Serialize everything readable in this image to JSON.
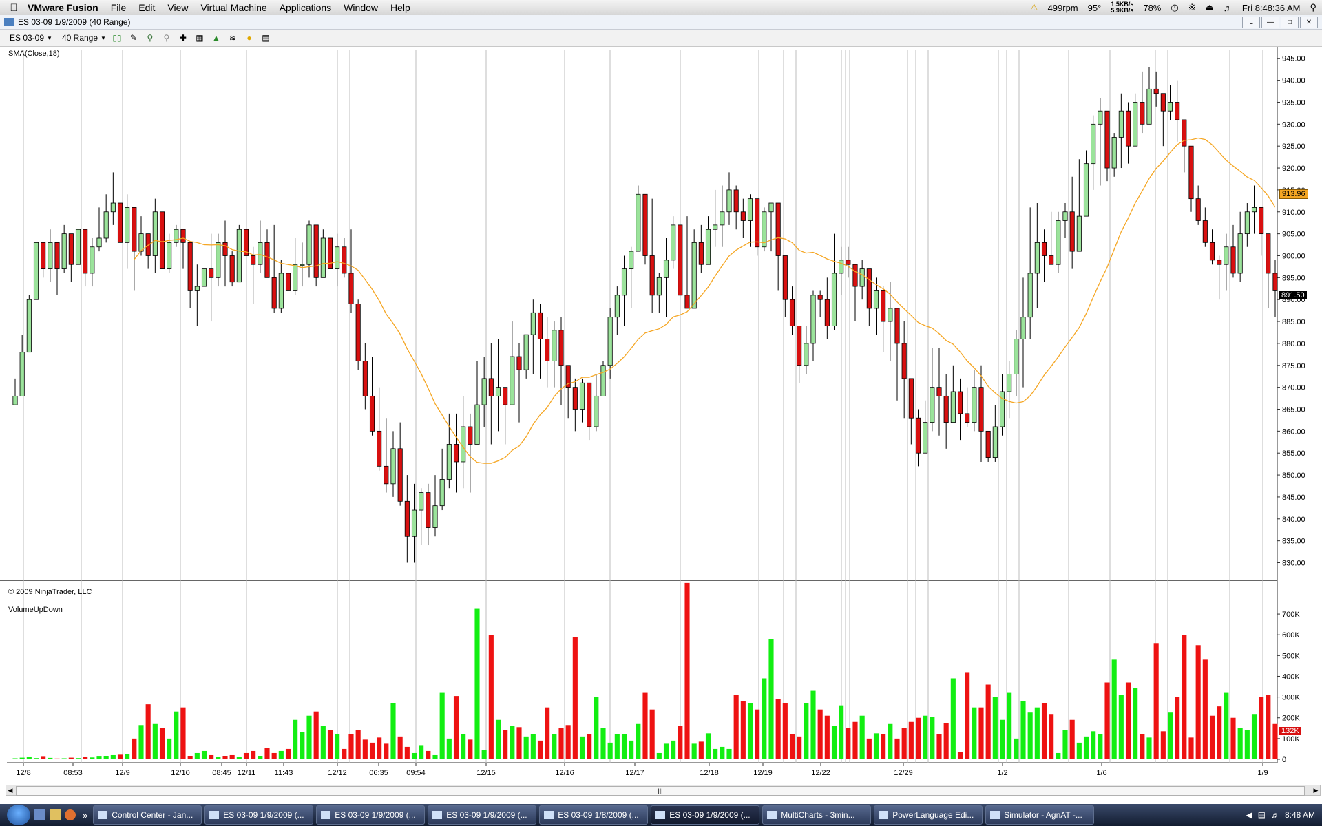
{
  "menubar": {
    "app_name": "VMware Fusion",
    "items": [
      "File",
      "Edit",
      "View",
      "Virtual Machine",
      "Applications",
      "Window",
      "Help"
    ],
    "status": {
      "fan": "499rpm",
      "temp": "95°",
      "net_up": "1.5KB/s",
      "net_down": "5.9KB/s",
      "battery": "78%",
      "clock": "Fri 8:48:36 AM"
    }
  },
  "window": {
    "title": "ES 03-09  1/9/2009 (40 Range)"
  },
  "toolbar": {
    "instrument": "ES 03-09",
    "period": "40 Range"
  },
  "price_panel": {
    "indicator_label": "SMA(Close,18)",
    "copyright": "© 2009 NinjaTrader, LLC",
    "sma_marker": "913.96",
    "last_marker": "891.50"
  },
  "volume_panel": {
    "indicator_label": "VolumeUpDown",
    "last_marker": "132K"
  },
  "chart_data": [
    {
      "type": "candlestick",
      "ylim": [
        826,
        947
      ],
      "yticks": [
        830,
        835,
        840,
        845,
        850,
        855,
        860,
        865,
        870,
        875,
        880,
        885,
        890,
        895,
        900,
        905,
        910,
        915,
        920,
        925,
        930,
        935,
        940,
        945
      ],
      "x_tick_labels": [
        "12/8",
        "08:53",
        "12/9",
        "12/10",
        "08:45",
        "12/11",
        "11:43",
        "12/12",
        "06:35",
        "09:54",
        "12/15",
        "12/16",
        "12/17",
        "12/18",
        "12/19",
        "12/22",
        "12/29",
        "1/2",
        "1/6",
        "1/9"
      ],
      "session_lines": true,
      "close": [
        868,
        878,
        890,
        903,
        897,
        903,
        897,
        905,
        898,
        906,
        896,
        902,
        904,
        910,
        912,
        903,
        911,
        901,
        905,
        900,
        910,
        897,
        903,
        906,
        903,
        892,
        893,
        897,
        895,
        903,
        900,
        894,
        906,
        900,
        898,
        903,
        895,
        888,
        896,
        892,
        898,
        898,
        907,
        895,
        904,
        897,
        902,
        896,
        889,
        876,
        868,
        860,
        852,
        848,
        856,
        844,
        836,
        842,
        846,
        838,
        843,
        849,
        857,
        853,
        861,
        857,
        866,
        872,
        868,
        870,
        866,
        877,
        874,
        882,
        887,
        881,
        876,
        883,
        875,
        870,
        865,
        871,
        861,
        868,
        875,
        886,
        891,
        897,
        901,
        914,
        900,
        891,
        895,
        899,
        907,
        891,
        888,
        903,
        898,
        906,
        907,
        910,
        915,
        910,
        908,
        913,
        902,
        910,
        912,
        900,
        890,
        884,
        875,
        880,
        891,
        890,
        884,
        896,
        899,
        898,
        893,
        897,
        888,
        892,
        885,
        888,
        880,
        872,
        863,
        855,
        862,
        870,
        868,
        862,
        869,
        864,
        862,
        870,
        860,
        854,
        861,
        869,
        873,
        881,
        886,
        896,
        903,
        900,
        898,
        908,
        910,
        901,
        909,
        921,
        930,
        933,
        920,
        927,
        933,
        925,
        935,
        930,
        938,
        937,
        933,
        935,
        931,
        925,
        913,
        908,
        903,
        899,
        898,
        902,
        896,
        905,
        910,
        911,
        905,
        896,
        892
      ],
      "high": [
        872,
        882,
        891,
        905,
        903,
        906,
        898,
        907,
        905,
        908,
        902,
        904,
        911,
        914,
        919,
        911,
        914,
        904,
        909,
        903,
        913,
        905,
        905,
        907,
        904,
        894,
        898,
        905,
        905,
        905,
        908,
        901,
        907,
        906,
        902,
        908,
        906,
        907,
        899,
        905,
        904,
        903,
        908,
        902,
        906,
        903,
        905,
        904,
        906,
        890,
        880,
        877,
        870,
        863,
        860,
        862,
        850,
        848,
        847,
        848,
        850,
        856,
        864,
        864,
        868,
        864,
        876,
        877,
        880,
        881,
        869,
        885,
        880,
        882,
        890,
        889,
        886,
        885,
        886,
        874,
        872,
        872,
        867,
        873,
        876,
        888,
        893,
        900,
        902,
        916,
        912,
        913,
        896,
        904,
        909,
        903,
        909,
        906,
        907,
        909,
        915,
        916,
        919,
        916,
        913,
        914,
        905,
        911,
        912,
        907,
        899,
        893,
        880,
        884,
        892,
        892,
        895,
        905,
        902,
        902,
        898,
        899,
        891,
        895,
        893,
        894,
        887,
        885,
        872,
        865,
        867,
        879,
        879,
        873,
        875,
        872,
        870,
        874,
        875,
        859,
        866,
        873,
        876,
        883,
        895,
        911,
        912,
        906,
        910,
        910,
        912,
        918,
        922,
        924,
        932,
        936,
        928,
        928,
        937,
        935,
        937,
        942,
        943,
        942,
        937,
        939,
        940,
        930,
        919,
        916,
        911,
        906,
        900,
        905,
        907,
        910,
        912,
        916,
        910,
        902,
        899
      ],
      "low": [
        866,
        868,
        878,
        889,
        895,
        894,
        891,
        896,
        894,
        899,
        893,
        893,
        901,
        903,
        907,
        902,
        897,
        892,
        900,
        897,
        896,
        896,
        896,
        902,
        897,
        888,
        884,
        890,
        885,
        893,
        893,
        893,
        895,
        895,
        889,
        896,
        895,
        887,
        887,
        884,
        891,
        893,
        895,
        893,
        895,
        892,
        893,
        895,
        887,
        874,
        865,
        859,
        851,
        846,
        845,
        843,
        830,
        830,
        834,
        834,
        836,
        842,
        847,
        846,
        847,
        846,
        857,
        861,
        857,
        860,
        857,
        870,
        862,
        872,
        873,
        872,
        870,
        870,
        866,
        863,
        860,
        862,
        858,
        860,
        868,
        872,
        882,
        884,
        888,
        902,
        898,
        887,
        887,
        886,
        897,
        891,
        888,
        890,
        896,
        898,
        902,
        902,
        907,
        906,
        904,
        902,
        900,
        901,
        901,
        892,
        886,
        882,
        871,
        873,
        876,
        886,
        881,
        883,
        891,
        895,
        885,
        890,
        884,
        882,
        878,
        876,
        867,
        863,
        857,
        852,
        856,
        860,
        859,
        856,
        862,
        858,
        861,
        860,
        853,
        853,
        853,
        859,
        863,
        868,
        870,
        881,
        888,
        894,
        898,
        896,
        904,
        897,
        901,
        910,
        915,
        916,
        917,
        918,
        920,
        921,
        925,
        928,
        931,
        934,
        925,
        931,
        926,
        919,
        910,
        907,
        902,
        898,
        890,
        892,
        895,
        894,
        902,
        905,
        900,
        888,
        886
      ],
      "volume_K": [
        5,
        8,
        10,
        6,
        12,
        7,
        4,
        5,
        8,
        6,
        10,
        9,
        13,
        15,
        20,
        22,
        25,
        100,
        165,
        265,
        170,
        150,
        100,
        230,
        250,
        15,
        30,
        40,
        20,
        10,
        15,
        20,
        10,
        30,
        40,
        15,
        55,
        30,
        40,
        50,
        190,
        130,
        210,
        230,
        160,
        140,
        120,
        50,
        120,
        140,
        95,
        80,
        105,
        75,
        270,
        110,
        60,
        30,
        65,
        40,
        20,
        320,
        100,
        305,
        120,
        95,
        725,
        45,
        600,
        190,
        140,
        160,
        155,
        110,
        120,
        90,
        250,
        120,
        150,
        165,
        590,
        110,
        120,
        300,
        150,
        80,
        120,
        120,
        90,
        170,
        320,
        240,
        30,
        75,
        90,
        160,
        850,
        75,
        85,
        125,
        50,
        60,
        50,
        310,
        280,
        270,
        240,
        390,
        580,
        290,
        270,
        120,
        110,
        270,
        330,
        240,
        210,
        160,
        260,
        150,
        180,
        210,
        100,
        125,
        120,
        170,
        100,
        150,
        180,
        200,
        210,
        205,
        120,
        175,
        390,
        35,
        420,
        250,
        250,
        360,
        300,
        190,
        320,
        100,
        280,
        225,
        250,
        270,
        215,
        30,
        140,
        190,
        80,
        110,
        135,
        120,
        370,
        480,
        310,
        370,
        345,
        120,
        105,
        560,
        135,
        225,
        300,
        600,
        105,
        550,
        480,
        210,
        255,
        320,
        200,
        150,
        140,
        215,
        300,
        310,
        170,
        35,
        95,
        132
      ]
    }
  ]
}
